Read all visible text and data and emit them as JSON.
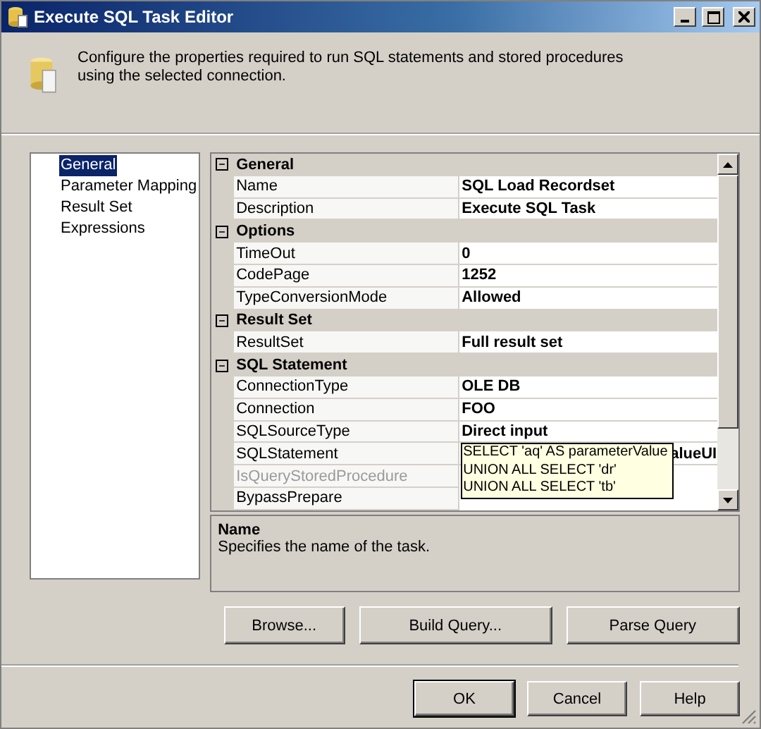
{
  "window": {
    "title": "Execute SQL Task Editor"
  },
  "header": {
    "text": "Configure the properties required to run SQL statements and stored procedures using the selected connection."
  },
  "nav": [
    {
      "label": "General",
      "selected": true
    },
    {
      "label": "Parameter Mapping",
      "selected": false
    },
    {
      "label": "Result Set",
      "selected": false
    },
    {
      "label": "Expressions",
      "selected": false
    }
  ],
  "properties": [
    {
      "category": "General",
      "expanded": true,
      "rows": [
        {
          "name": "Name",
          "value": "SQL Load Recordset",
          "disabled": false
        },
        {
          "name": "Description",
          "value": "Execute SQL Task",
          "disabled": false
        }
      ]
    },
    {
      "category": "Options",
      "expanded": true,
      "rows": [
        {
          "name": "TimeOut",
          "value": "0",
          "disabled": false
        },
        {
          "name": "CodePage",
          "value": "1252",
          "disabled": false
        },
        {
          "name": "TypeConversionMode",
          "value": "Allowed",
          "disabled": false
        }
      ]
    },
    {
      "category": "Result Set",
      "expanded": true,
      "rows": [
        {
          "name": "ResultSet",
          "value": "Full result set",
          "disabled": false
        }
      ]
    },
    {
      "category": "SQL Statement",
      "expanded": true,
      "rows": [
        {
          "name": "ConnectionType",
          "value": "OLE DB",
          "disabled": false
        },
        {
          "name": "Connection",
          "value": "FOO",
          "disabled": false
        },
        {
          "name": "SQLSourceType",
          "value": "Direct input",
          "disabled": false
        },
        {
          "name": "SQLStatement",
          "value": "alueUI",
          "disabled": false,
          "tooltip": [
            "SELECT 'aq' AS parameterValue",
            "UNION ALL SELECT 'dr'",
            "UNION ALL SELECT 'tb'"
          ]
        },
        {
          "name": "IsQueryStoredProcedure",
          "disabled": true
        },
        {
          "name": "BypassPrepare",
          "disabled": false
        }
      ]
    }
  ],
  "description": {
    "title": "Name",
    "text": "Specifies the name of the task."
  },
  "action_buttons": [
    "Browse...",
    "Build Query...",
    "Parse Query"
  ],
  "dialog_buttons": [
    {
      "label": "OK",
      "default": true
    },
    {
      "label": "Cancel",
      "default": false
    },
    {
      "label": "Help",
      "default": false
    }
  ]
}
